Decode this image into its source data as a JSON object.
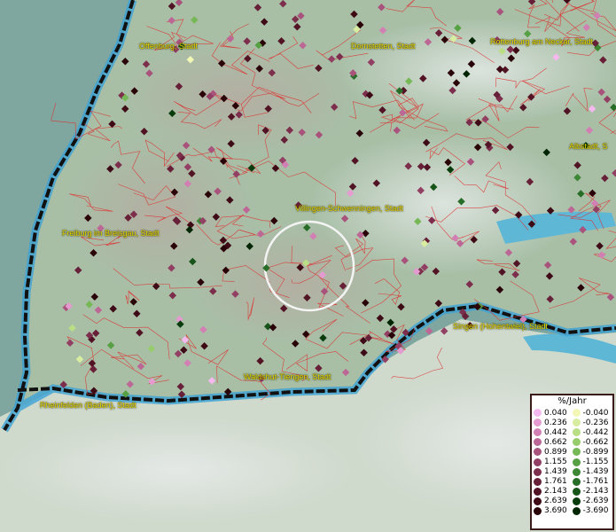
{
  "map": {
    "cities": [
      {
        "id": "offenburg",
        "name": "Offenburg, Stadt"
      },
      {
        "id": "dornstetten",
        "name": "Dornstetten, Stadt"
      },
      {
        "id": "rottenburg",
        "name": "Rottenburg am Neckar, Stadt"
      },
      {
        "id": "albstadt",
        "name": "Albstadt, S"
      },
      {
        "id": "villingen",
        "name": "Villingen-Schwenningen, Stadt"
      },
      {
        "id": "freiburg",
        "name": "Freiburg im Breisgau, Stadt"
      },
      {
        "id": "singen",
        "name": "Singen (Hohentwiel), Stadt"
      },
      {
        "id": "waldshut",
        "name": "Waldshut-Tiengen, Stadt"
      },
      {
        "id": "rheinfelden",
        "name": "Rheinfelden (Baden), Stadt"
      }
    ]
  },
  "legend": {
    "title": "%/Jahr",
    "positive": [
      {
        "label": "0.040",
        "color": "#f5b8ee"
      },
      {
        "label": "0.236",
        "color": "#e59ad0"
      },
      {
        "label": "0.442",
        "color": "#d27fb3"
      },
      {
        "label": "0.662",
        "color": "#bd6796"
      },
      {
        "label": "0.899",
        "color": "#a8527c"
      },
      {
        "label": "1.155",
        "color": "#923f63"
      },
      {
        "label": "1.439",
        "color": "#7c2e4c"
      },
      {
        "label": "1.761",
        "color": "#672037"
      },
      {
        "label": "2.143",
        "color": "#521425"
      },
      {
        "label": "2.639",
        "color": "#3d0a16"
      },
      {
        "label": "3.690",
        "color": "#2a0309"
      }
    ],
    "negative": [
      {
        "label": "-0.040",
        "color": "#f2f7b6"
      },
      {
        "label": "-0.236",
        "color": "#d8eda0"
      },
      {
        "label": "-0.442",
        "color": "#b9de86"
      },
      {
        "label": "-0.662",
        "color": "#97cc6c"
      },
      {
        "label": "-0.899",
        "color": "#76b756"
      },
      {
        "label": "-1.155",
        "color": "#57a044"
      },
      {
        "label": "-1.439",
        "color": "#3d8734"
      },
      {
        "label": "-1.761",
        "color": "#276d27"
      },
      {
        "label": "-2.143",
        "color": "#165419"
      },
      {
        "label": "-2.639",
        "color": "#093c0d"
      },
      {
        "label": "-3.690",
        "color": "#022604"
      }
    ]
  }
}
